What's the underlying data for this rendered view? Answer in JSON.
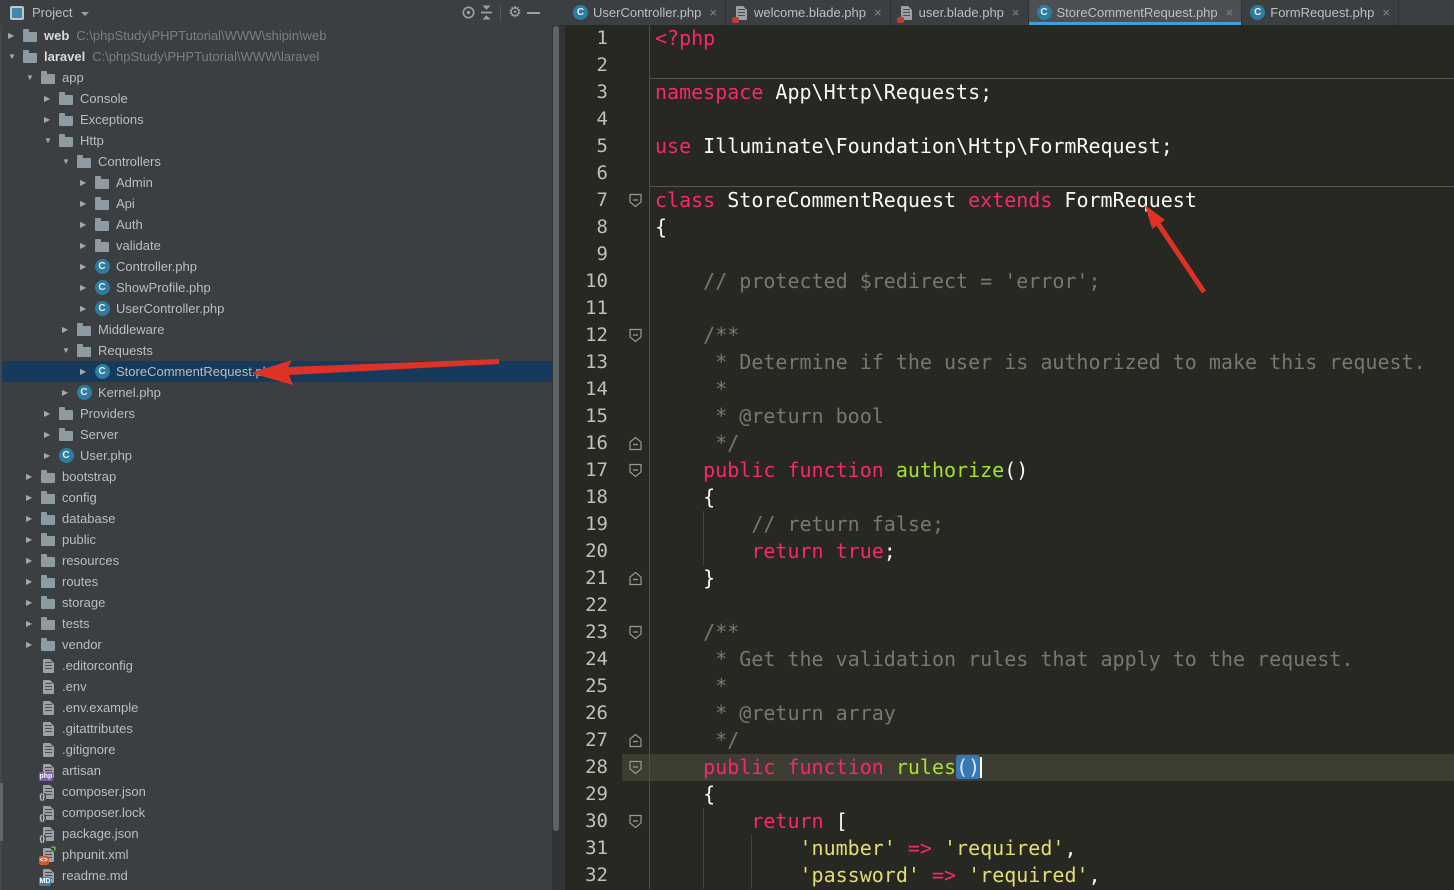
{
  "colors": {
    "panel_bg": "#3C3F41",
    "editor_bg": "#272822",
    "current_line_bg": "#3E3D32",
    "tree_selection_bg": "#153A5B",
    "keyword": "#F92672",
    "string": "#E6DB74",
    "function_name": "#A6E22E",
    "comment": "#7A776C",
    "plain_text": "#F8F8F2",
    "tab_underline": "#41A0DC",
    "paren_selection_bg": "#3878B4",
    "annotation_arrow_red": "#DE3226",
    "php_class_icon": "#2E7D9E"
  },
  "toolbar": {
    "title": "Project",
    "icons": [
      "project-tool-window-icon",
      "dropdown-arrow-icon",
      "locate-icon",
      "collapse-all-icon",
      "settings-gear-icon",
      "hide-panel-icon"
    ]
  },
  "tree": {
    "items": [
      {
        "label": "web",
        "path": "C:\\phpStudy\\PHPTutorial\\WWW\\shipin\\web",
        "depth": 0,
        "icon": "folder",
        "expand": "closed",
        "bold": true
      },
      {
        "label": "laravel",
        "path": "C:\\phpStudy\\PHPTutorial\\WWW\\laravel",
        "depth": 0,
        "icon": "folder",
        "expand": "open",
        "bold": true
      },
      {
        "label": "app",
        "depth": 1,
        "icon": "folder",
        "expand": "open"
      },
      {
        "label": "Console",
        "depth": 2,
        "icon": "folder",
        "expand": "closed"
      },
      {
        "label": "Exceptions",
        "depth": 2,
        "icon": "folder",
        "expand": "closed"
      },
      {
        "label": "Http",
        "depth": 2,
        "icon": "folder",
        "expand": "open"
      },
      {
        "label": "Controllers",
        "depth": 3,
        "icon": "folder",
        "expand": "open"
      },
      {
        "label": "Admin",
        "depth": 4,
        "icon": "folder",
        "expand": "closed"
      },
      {
        "label": "Api",
        "depth": 4,
        "icon": "folder",
        "expand": "closed"
      },
      {
        "label": "Auth",
        "depth": 4,
        "icon": "folder",
        "expand": "closed"
      },
      {
        "label": "validate",
        "depth": 4,
        "icon": "folder",
        "expand": "closed"
      },
      {
        "label": "Controller.php",
        "depth": 4,
        "icon": "php-class",
        "expand": "closed"
      },
      {
        "label": "ShowProfile.php",
        "depth": 4,
        "icon": "php-class",
        "expand": "closed"
      },
      {
        "label": "UserController.php",
        "depth": 4,
        "icon": "php-class",
        "expand": "closed"
      },
      {
        "label": "Middleware",
        "depth": 3,
        "icon": "folder",
        "expand": "closed"
      },
      {
        "label": "Requests",
        "depth": 3,
        "icon": "folder",
        "expand": "open"
      },
      {
        "label": "StoreCommentRequest.php",
        "depth": 4,
        "icon": "php-class",
        "expand": "closed",
        "selected": true
      },
      {
        "label": "Kernel.php",
        "depth": 3,
        "icon": "php-class",
        "expand": "closed"
      },
      {
        "label": "Providers",
        "depth": 2,
        "icon": "folder",
        "expand": "closed"
      },
      {
        "label": "Server",
        "depth": 2,
        "icon": "folder",
        "expand": "closed"
      },
      {
        "label": "User.php",
        "depth": 2,
        "icon": "php-class",
        "expand": "closed"
      },
      {
        "label": "bootstrap",
        "depth": 1,
        "icon": "folder",
        "expand": "closed"
      },
      {
        "label": "config",
        "depth": 1,
        "icon": "folder",
        "expand": "closed"
      },
      {
        "label": "database",
        "depth": 1,
        "icon": "folder",
        "expand": "closed"
      },
      {
        "label": "public",
        "depth": 1,
        "icon": "folder",
        "expand": "closed"
      },
      {
        "label": "resources",
        "depth": 1,
        "icon": "folder",
        "expand": "closed"
      },
      {
        "label": "routes",
        "depth": 1,
        "icon": "folder",
        "expand": "closed"
      },
      {
        "label": "storage",
        "depth": 1,
        "icon": "folder",
        "expand": "closed"
      },
      {
        "label": "tests",
        "depth": 1,
        "icon": "folder",
        "expand": "closed"
      },
      {
        "label": "vendor",
        "depth": 1,
        "icon": "folder",
        "expand": "closed"
      },
      {
        "label": ".editorconfig",
        "depth": 1,
        "icon": "text-file"
      },
      {
        "label": ".env",
        "depth": 1,
        "icon": "text-file"
      },
      {
        "label": ".env.example",
        "depth": 1,
        "icon": "text-file"
      },
      {
        "label": ".gitattributes",
        "depth": 1,
        "icon": "text-file"
      },
      {
        "label": ".gitignore",
        "depth": 1,
        "icon": "text-file"
      },
      {
        "label": "artisan",
        "depth": 1,
        "icon": "php-file"
      },
      {
        "label": "composer.json",
        "depth": 1,
        "icon": "json-file"
      },
      {
        "label": "composer.lock",
        "depth": 1,
        "icon": "json-file"
      },
      {
        "label": "package.json",
        "depth": 1,
        "icon": "json-file"
      },
      {
        "label": "phpunit.xml",
        "depth": 1,
        "icon": "xml-file"
      },
      {
        "label": "readme.md",
        "depth": 1,
        "icon": "md-file"
      }
    ]
  },
  "tabs": [
    {
      "label": "UserController.php",
      "icon": "php-class",
      "active": false
    },
    {
      "label": "welcome.blade.php",
      "icon": "blade-template",
      "active": false
    },
    {
      "label": "user.blade.php",
      "icon": "blade-template",
      "active": false
    },
    {
      "label": "StoreCommentRequest.php",
      "icon": "php-class",
      "active": true
    },
    {
      "label": "FormRequest.php",
      "icon": "php-class",
      "active": false
    }
  ],
  "editor": {
    "current_line": 28,
    "method_separators_above_lines": [
      3,
      7
    ],
    "folds": {
      "7": "start",
      "12": "start",
      "16": "end",
      "17": "start",
      "21": "end",
      "23": "start",
      "27": "end",
      "28": "start",
      "30": "start"
    },
    "indent_guides": [
      {
        "col": 4,
        "from": 19,
        "to": 20
      },
      {
        "col": 4,
        "from": 30,
        "to": 32
      },
      {
        "col": 8,
        "from": 31,
        "to": 32
      }
    ],
    "lines": [
      {
        "n": 1,
        "t": [
          [
            "k",
            "<?php"
          ]
        ]
      },
      {
        "n": 2,
        "t": []
      },
      {
        "n": 3,
        "t": [
          [
            "k",
            "namespace"
          ],
          [
            "n",
            " App\\Http\\Requests;"
          ]
        ]
      },
      {
        "n": 4,
        "t": []
      },
      {
        "n": 5,
        "t": [
          [
            "k",
            "use"
          ],
          [
            "n",
            " Illuminate\\Foundation\\Http\\FormRequest;"
          ]
        ]
      },
      {
        "n": 6,
        "t": []
      },
      {
        "n": 7,
        "t": [
          [
            "k",
            "class"
          ],
          [
            "n",
            " StoreCommentRequest "
          ],
          [
            "k",
            "extends"
          ],
          [
            "n",
            " FormRequest"
          ]
        ]
      },
      {
        "n": 8,
        "t": [
          [
            "n",
            "{"
          ]
        ]
      },
      {
        "n": 9,
        "t": []
      },
      {
        "n": 10,
        "t": [
          [
            "c",
            "    // protected $redirect = 'error';"
          ]
        ]
      },
      {
        "n": 11,
        "t": []
      },
      {
        "n": 12,
        "t": [
          [
            "c",
            "    /**"
          ]
        ]
      },
      {
        "n": 13,
        "t": [
          [
            "c",
            "     * Determine if the user is authorized to make this request."
          ]
        ]
      },
      {
        "n": 14,
        "t": [
          [
            "c",
            "     *"
          ]
        ]
      },
      {
        "n": 15,
        "t": [
          [
            "c",
            "     * @return bool"
          ]
        ]
      },
      {
        "n": 16,
        "t": [
          [
            "c",
            "     */"
          ]
        ]
      },
      {
        "n": 17,
        "t": [
          [
            "n",
            "    "
          ],
          [
            "k",
            "public"
          ],
          [
            "n",
            " "
          ],
          [
            "k",
            "function"
          ],
          [
            "n",
            " "
          ],
          [
            "f",
            "authorize"
          ],
          [
            "n",
            "()"
          ]
        ]
      },
      {
        "n": 18,
        "t": [
          [
            "n",
            "    {"
          ]
        ]
      },
      {
        "n": 19,
        "t": [
          [
            "c",
            "        // return false;"
          ]
        ]
      },
      {
        "n": 20,
        "t": [
          [
            "n",
            "        "
          ],
          [
            "k",
            "return"
          ],
          [
            "n",
            " "
          ],
          [
            "k",
            "true"
          ],
          [
            "n",
            ";"
          ]
        ]
      },
      {
        "n": 21,
        "t": [
          [
            "n",
            "    }"
          ]
        ]
      },
      {
        "n": 22,
        "t": []
      },
      {
        "n": 23,
        "t": [
          [
            "c",
            "    /**"
          ]
        ]
      },
      {
        "n": 24,
        "t": [
          [
            "c",
            "     * Get the validation rules that apply to the request."
          ]
        ]
      },
      {
        "n": 25,
        "t": [
          [
            "c",
            "     *"
          ]
        ]
      },
      {
        "n": 26,
        "t": [
          [
            "c",
            "     * @return array"
          ]
        ]
      },
      {
        "n": 27,
        "t": [
          [
            "c",
            "     */"
          ]
        ]
      },
      {
        "n": 28,
        "t": [
          [
            "n",
            "    "
          ],
          [
            "k",
            "public"
          ],
          [
            "n",
            " "
          ],
          [
            "k",
            "function"
          ],
          [
            "n",
            " "
          ],
          [
            "f",
            "rules"
          ],
          [
            "sel",
            "()"
          ],
          [
            "caret",
            ""
          ]
        ]
      },
      {
        "n": 29,
        "t": [
          [
            "n",
            "    {"
          ]
        ]
      },
      {
        "n": 30,
        "t": [
          [
            "n",
            "        "
          ],
          [
            "k",
            "return"
          ],
          [
            "n",
            " ["
          ]
        ]
      },
      {
        "n": 31,
        "t": [
          [
            "n",
            "            "
          ],
          [
            "s",
            "'number'"
          ],
          [
            "n",
            " "
          ],
          [
            "k",
            "=>"
          ],
          [
            "n",
            " "
          ],
          [
            "s",
            "'required'"
          ],
          [
            "n",
            ","
          ]
        ]
      },
      {
        "n": 32,
        "t": [
          [
            "n",
            "            "
          ],
          [
            "s",
            "'password'"
          ],
          [
            "n",
            " "
          ],
          [
            "k",
            "=>"
          ],
          [
            "n",
            " "
          ],
          [
            "s",
            "'required'"
          ],
          [
            "n",
            ","
          ]
        ]
      }
    ]
  },
  "annotations": {
    "arrows": [
      {
        "name": "red-arrow-to-selected-tree-file",
        "points_to": "StoreCommentRequest.php"
      },
      {
        "name": "red-arrow-to-formrequest",
        "points_to": "FormRequest"
      }
    ]
  }
}
